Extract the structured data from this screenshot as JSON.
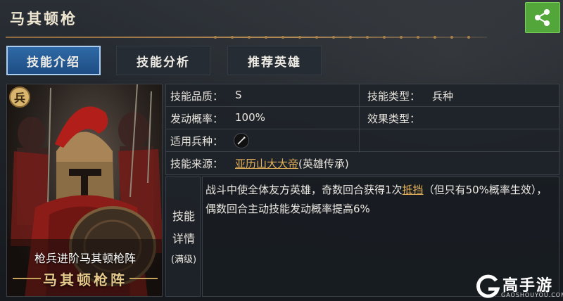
{
  "header": {
    "title": "马其顿枪"
  },
  "share": {
    "icon": "share-icon"
  },
  "tabs": [
    {
      "label": "技能介绍",
      "active": true
    },
    {
      "label": "技能分析",
      "active": false
    },
    {
      "label": "推荐英雄",
      "active": false
    }
  ],
  "portrait": {
    "badge": "兵",
    "caption": "枪兵进阶马其顿枪阵",
    "name": "马其顿枪阵"
  },
  "info": {
    "quality_label": "技能品质：",
    "quality_value": "S",
    "type_label": "技能类型：",
    "type_value": "兵种",
    "trigger_label": "发动概率：",
    "trigger_value": "100%",
    "effect_label": "效果类型：",
    "effect_value": "",
    "troop_label": "适用兵种：",
    "troop_icon": "spear-icon",
    "source_label": "技能来源：",
    "source_link": "亚历山大大帝",
    "source_suffix": "(英雄传承)"
  },
  "detail": {
    "head_line1": "技能",
    "head_line2": "详情",
    "head_line3": "(满级)",
    "text_part1": "战斗中使全体友方英雄，奇数回合获得1次",
    "text_link": "抵挡",
    "text_part2": "（但只有50%概率生效），偶数回合主动技能发动概率提高6%"
  },
  "watermark": {
    "name": "高手游",
    "domain": "GAOSHOUYOU.COM"
  },
  "colors": {
    "accent_green": "#52a63a",
    "tab_active": "#2f6aa6",
    "link": "#e7b35a"
  }
}
